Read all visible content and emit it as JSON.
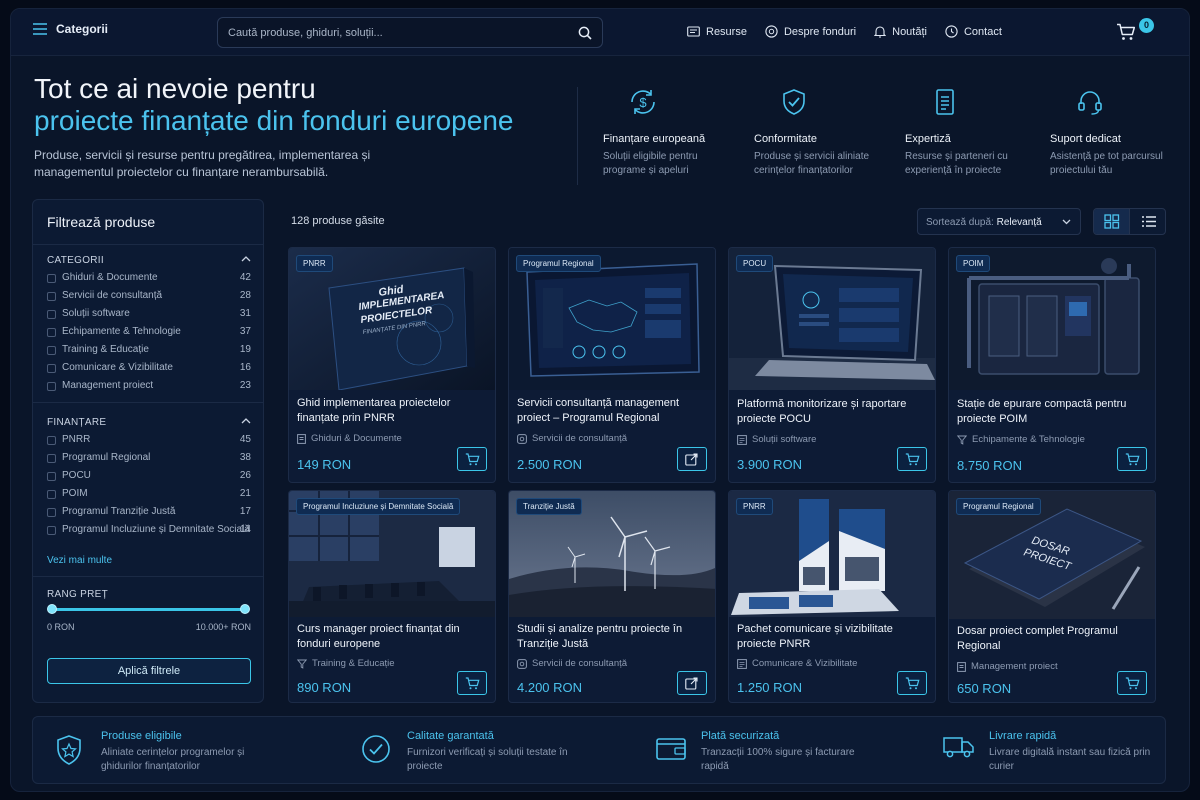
{
  "topbar": {
    "categories_label": "Categorii",
    "search_placeholder": "Caută produse, ghiduri, soluții...",
    "nav": [
      "Resurse",
      "Despre fonduri",
      "Noutăți",
      "Contact"
    ],
    "cart_count": "0"
  },
  "hero": {
    "title_line1": "Tot ce ai nevoie pentru",
    "title_line2": "proiecte finanțate din fonduri europene",
    "subtitle": "Produse, servicii și resurse pentru pregătirea, implementarea și managementul proiectelor cu finanțare nerambursabilă.",
    "features": [
      {
        "icon": "dollar-refresh-icon",
        "title": "Finanțare europeană",
        "desc": "Soluții eligibile pentru programe și apeluri"
      },
      {
        "icon": "shield-check-icon",
        "title": "Conformitate",
        "desc": "Produse și servicii aliniate cerințelor finanțatorilor"
      },
      {
        "icon": "document-icon",
        "title": "Expertiză",
        "desc": "Resurse și parteneri cu experiență în proiecte"
      },
      {
        "icon": "headset-icon",
        "title": "Suport dedicat",
        "desc": "Asistență pe tot parcursul proiectului tău"
      }
    ]
  },
  "sidebar": {
    "title": "Filtrează produse",
    "categories_heading": "CATEGORII",
    "categories": [
      {
        "label": "Ghiduri & Documente",
        "count": "42"
      },
      {
        "label": "Servicii de consultanță",
        "count": "28"
      },
      {
        "label": "Soluții software",
        "count": "31"
      },
      {
        "label": "Echipamente & Tehnologie",
        "count": "37"
      },
      {
        "label": "Training & Educație",
        "count": "19"
      },
      {
        "label": "Comunicare & Vizibilitate",
        "count": "16"
      },
      {
        "label": "Management proiect",
        "count": "23"
      }
    ],
    "funding_heading": "FINANȚARE",
    "funding": [
      {
        "label": "PNRR",
        "count": "45"
      },
      {
        "label": "Programul Regional",
        "count": "38"
      },
      {
        "label": "POCU",
        "count": "26"
      },
      {
        "label": "POIM",
        "count": "21"
      },
      {
        "label": "Programul Tranziție Justă",
        "count": "17"
      },
      {
        "label": "Programul Incluziune și Demnitate Socială",
        "count": "14"
      }
    ],
    "see_more": "Vezi mai multe",
    "price_heading": "RANG PREȚ",
    "price_min_label": "0 RON",
    "price_max_label": "10.000+ RON",
    "price_range_selected": [
      0,
      1
    ],
    "apply_label": "Aplică filtrele"
  },
  "results": {
    "count_label": "128 produse găsite",
    "sort_prefix": "Sortează după:",
    "sort_value": "Relevanță"
  },
  "products": [
    {
      "badge": "PNRR",
      "title": "Ghid implementarea proiectelor finanțate prin PNRR",
      "category": "Ghiduri & Documente",
      "category_icon": "document-icon",
      "price": "149 RON",
      "action": "cart",
      "image": "book-cover",
      "image_text": [
        "Ghid",
        "IMPLEMENTAREA",
        "PROIECTELOR",
        "FINANȚATE DIN PNRR"
      ]
    },
    {
      "badge": "Programul Regional",
      "title": "Servicii consultanță management proiect – Programul Regional",
      "category": "Servicii de consultanță",
      "category_icon": "consulting-icon",
      "price": "2.500 RON",
      "action": "external",
      "image": "monitor-dashboard",
      "image_text": []
    },
    {
      "badge": "POCU",
      "title": "Platformă monitorizare și raportare proiecte POCU",
      "category": "Soluții software",
      "category_icon": "software-icon",
      "price": "3.900 RON",
      "action": "cart",
      "image": "laptop",
      "image_text": []
    },
    {
      "badge": "POIM",
      "title": "Stație de epurare compactă pentru proiecte POIM",
      "category": "Echipamente & Tehnologie",
      "category_icon": "filter-icon",
      "price": "8.750 RON",
      "action": "cart",
      "image": "machinery",
      "image_text": []
    },
    {
      "badge": "Programul Incluziune și Demnitate Socială",
      "title": "Curs manager proiect finanțat din fonduri europene",
      "category": "Training & Educație",
      "category_icon": "filter-icon",
      "price": "890 RON",
      "action": "cart",
      "image": "conference-room",
      "image_text": []
    },
    {
      "badge": "Tranziție Justă",
      "title": "Studii și analize pentru proiecte în Tranziție Justă",
      "category": "Servicii de consultanță",
      "category_icon": "consulting-icon",
      "price": "4.200 RON",
      "action": "external",
      "image": "wind-turbines",
      "image_text": []
    },
    {
      "badge": "PNRR",
      "title": "Pachet comunicare și vizibilitate proiecte PNRR",
      "category": "Comunicare & Vizibilitate",
      "category_icon": "software-icon",
      "price": "1.250 RON",
      "action": "cart",
      "image": "banners",
      "image_text": []
    },
    {
      "badge": "Programul Regional",
      "title": "Dosar proiect complet Programul Regional",
      "category": "Management proiect",
      "category_icon": "document-icon",
      "price": "650 RON",
      "action": "cart",
      "image": "folder",
      "image_text": [
        "DOSAR",
        "PROIECT"
      ]
    }
  ],
  "bottom_features": [
    {
      "icon": "shield-star-icon",
      "title": "Produse eligibile",
      "desc": "Aliniate cerințelor programelor și ghidurilor finanțatorilor"
    },
    {
      "icon": "check-circle-icon",
      "title": "Calitate garantată",
      "desc": "Furnizori verificați și soluții testate în proiecte"
    },
    {
      "icon": "wallet-icon",
      "title": "Plată securizată",
      "desc": "Tranzacții 100% sigure și facturare rapidă"
    },
    {
      "icon": "truck-icon",
      "title": "Livrare rapidă",
      "desc": "Livrare digitală instant sau fizică prin curier"
    }
  ],
  "colors": {
    "accent": "#4bc3ee",
    "background": "#0a1529",
    "card": "#0d1b35"
  }
}
